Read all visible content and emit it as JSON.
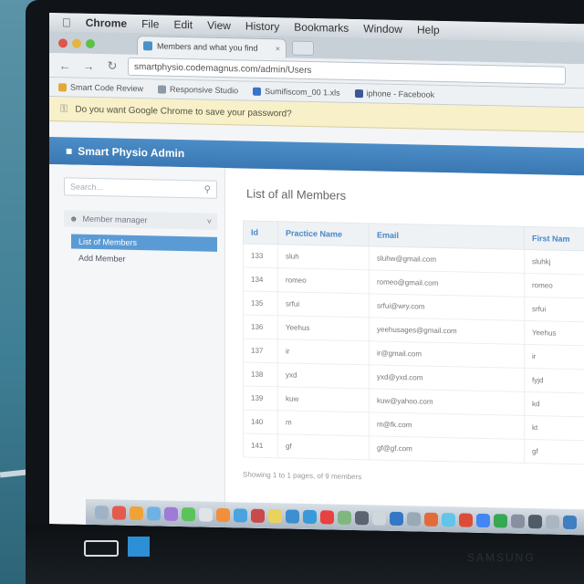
{
  "menubar": {
    "apple": "",
    "items": [
      "Chrome",
      "File",
      "Edit",
      "View",
      "History",
      "Bookmarks",
      "Window",
      "Help"
    ]
  },
  "tab": {
    "title": "Members and what you find"
  },
  "toolbar": {
    "url": "smartphysio.codemagnus.com/admin/Users"
  },
  "bookmarks": [
    {
      "label": "Smart Code Review",
      "color": "#e0a93a"
    },
    {
      "label": "Responsive Studio",
      "color": "#8b9aa7"
    },
    {
      "label": "Sumifiscom_00 1.xls",
      "color": "#3a72c8"
    },
    {
      "label": "iphone - Facebook",
      "color": "#3b5998"
    }
  ],
  "infobar": {
    "text": "Do you want Google Chrome to save your password?"
  },
  "admin": {
    "title": "Smart Physio Admin"
  },
  "sidebar": {
    "search_placeholder": "Search...",
    "section_label": "Member manager",
    "items": [
      {
        "label": "List of Members",
        "active": true
      },
      {
        "label": "Add Member",
        "active": false
      }
    ]
  },
  "main": {
    "heading": "List of all Members",
    "columns": [
      "Id",
      "Practice Name",
      "Email",
      "First Nam"
    ],
    "rows": [
      [
        "133",
        "sluh",
        "sluhw@gmail.com",
        "sluhkj"
      ],
      [
        "134",
        "romeo",
        "romeo@gmail.com",
        "romeo"
      ],
      [
        "135",
        "srfui",
        "srfui@wry.com",
        "srfui"
      ],
      [
        "136",
        "Yeehus",
        "yeehusages@gmail.com",
        "Yeehus"
      ],
      [
        "137",
        "ir",
        "ir@gmail.com",
        "ir"
      ],
      [
        "138",
        "yxd",
        "yxd@yxd.com",
        "fyjd"
      ],
      [
        "139",
        "kuw",
        "kuw@yahoo.com",
        "kd"
      ],
      [
        "140",
        "m",
        "m@fk.com",
        "kt"
      ],
      [
        "141",
        "gf",
        "gf@gf.com",
        "gf"
      ]
    ],
    "footer": "Showing 1 to 1 pages, of 9 members"
  },
  "dock": {
    "colors": [
      "#9fb3c6",
      "#e25b4b",
      "#f0a23a",
      "#6fb1e4",
      "#9d7bd6",
      "#5cc35c",
      "#dfe4e8",
      "#f28f3b",
      "#4aa3df",
      "#c94a4a",
      "#e9d25d",
      "#3e8ed0",
      "#3a9ad9",
      "#e94040",
      "#7fb77e",
      "#5b6470",
      "#cfd6dc",
      "#3477c4",
      "#9aa9b6",
      "#e36b3a",
      "#62c4e8",
      "#dd4b39",
      "#4285f4",
      "#34a853",
      "#888fa0",
      "#4f5b66",
      "#aab6c2",
      "#3d7fc1"
    ]
  },
  "monitor": {
    "brand": "SAMSUNG"
  }
}
